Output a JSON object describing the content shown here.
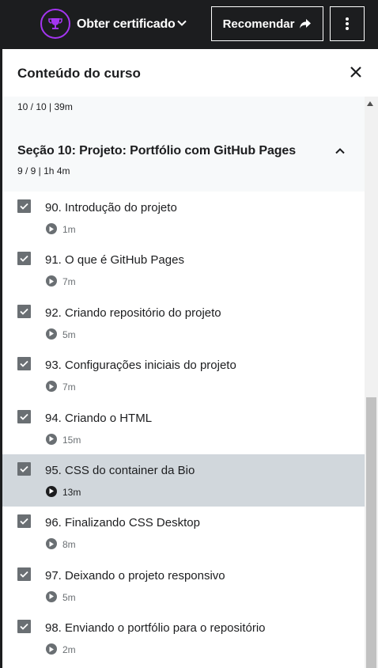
{
  "topbar": {
    "certificate_label": "Obter certificado",
    "recommend_label": "Recomendar",
    "accent_color": "#a435f0"
  },
  "panel": {
    "title": "Conteúdo do curso",
    "previous_section_meta": "10 / 10 | 39m",
    "section": {
      "title": "Seção 10: Projeto: Portfólio com GitHub Pages",
      "meta": "9 / 9 | 1h 4m",
      "expanded": true
    },
    "lectures": [
      {
        "title": "90. Introdução do projeto",
        "duration": "1m",
        "completed": true,
        "active": false
      },
      {
        "title": "91. O que é GitHub Pages",
        "duration": "7m",
        "completed": true,
        "active": false
      },
      {
        "title": "92. Criando repositório do projeto",
        "duration": "5m",
        "completed": true,
        "active": false
      },
      {
        "title": "93. Configurações iniciais do projeto",
        "duration": "7m",
        "completed": true,
        "active": false
      },
      {
        "title": "94. Criando o HTML",
        "duration": "15m",
        "completed": true,
        "active": false
      },
      {
        "title": "95. CSS do container da Bio",
        "duration": "13m",
        "completed": true,
        "active": true
      },
      {
        "title": "96. Finalizando CSS Desktop",
        "duration": "8m",
        "completed": true,
        "active": false
      },
      {
        "title": "97. Deixando o projeto responsivo",
        "duration": "5m",
        "completed": true,
        "active": false
      },
      {
        "title": "98. Enviando o portfólio para o repositório",
        "duration": "2m",
        "completed": true,
        "active": false
      }
    ]
  },
  "icons": {
    "certificate": "trophy-icon",
    "certificate_dropdown": "chevron-down-icon",
    "recommend": "share-arrow-icon",
    "more": "more-vertical-icon",
    "close": "close-icon",
    "section_toggle": "chevron-up-icon",
    "lecture_status": "checkbox-checked-icon",
    "lecture_type": "play-circle-icon"
  }
}
